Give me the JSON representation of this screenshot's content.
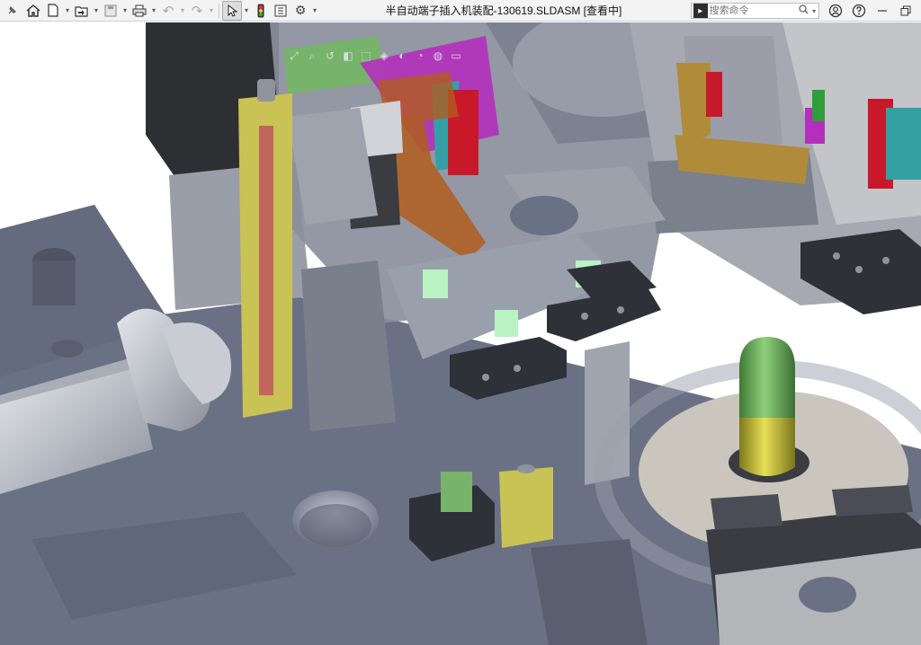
{
  "window": {
    "title": "半自动端子插入机装配-130619.SLDASM [查看中]"
  },
  "quick_access": {
    "items": [
      {
        "name": "pin-icon",
        "glyph": "📌"
      },
      {
        "name": "home-icon",
        "glyph": "⌂"
      },
      {
        "name": "new-document-icon",
        "glyph": "🗋"
      },
      {
        "name": "open-folder-icon",
        "glyph": "📂"
      },
      {
        "name": "save-icon",
        "glyph": "💾"
      },
      {
        "name": "print-icon",
        "glyph": "🖶"
      },
      {
        "name": "undo-icon",
        "glyph": "↶"
      },
      {
        "name": "redo-icon",
        "glyph": "↷"
      },
      {
        "name": "select-pointer-icon",
        "glyph": "↖"
      },
      {
        "name": "rebuild-traffic-light-icon",
        "glyph": "●"
      },
      {
        "name": "file-properties-icon",
        "glyph": "▤"
      },
      {
        "name": "options-gear-icon",
        "glyph": "⚙"
      }
    ]
  },
  "search": {
    "placeholder": "搜索命令",
    "logo": "▸"
  },
  "window_controls": {
    "account": "account-icon",
    "help": "help-icon",
    "minimize": "minimize-icon",
    "restore": "restore-icon"
  },
  "viewport": {
    "background": "#ffffff",
    "base_color": "#6b7185",
    "frame_color": "#8a8f9c",
    "highlight_colors": {
      "green": "#77b36b",
      "yellow": "#c9c254",
      "orange": "#b25d1e",
      "magenta": "#b42fbd",
      "red": "#c8192a",
      "teal": "#33a1a3",
      "brass": "#b08b3a",
      "lightgreen": "#b9f2c3"
    }
  }
}
